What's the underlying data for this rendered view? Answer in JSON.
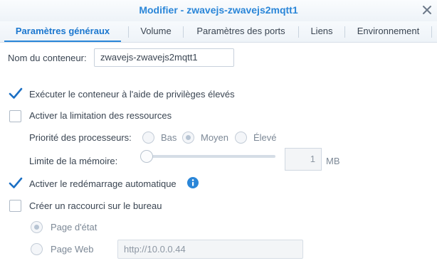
{
  "window": {
    "title": "Modifier - zwavejs-zwavejs2mqtt1"
  },
  "tabs": [
    {
      "label": "Paramètres généraux",
      "active": true
    },
    {
      "label": "Volume",
      "active": false
    },
    {
      "label": "Paramètres des ports",
      "active": false
    },
    {
      "label": "Liens",
      "active": false
    },
    {
      "label": "Environnement",
      "active": false
    }
  ],
  "container_name": {
    "label": "Nom du conteneur:",
    "value": "zwavejs-zwavejs2mqtt1"
  },
  "privileged": {
    "label": "Exécuter le conteneur à l'aide de privilèges élevés",
    "checked": true
  },
  "resource_limit": {
    "label": "Activer la limitation des ressources",
    "checked": false,
    "cpu_priority": {
      "label": "Priorité des processeurs:",
      "options": [
        "Bas",
        "Moyen",
        "Élevé"
      ],
      "selected": "Moyen"
    },
    "memory_limit": {
      "label": "Limite de la mémoire:",
      "value": "1",
      "unit": "MB"
    }
  },
  "auto_restart": {
    "label": "Activer le redémarrage automatique",
    "checked": true
  },
  "desktop_shortcut": {
    "label": "Créer un raccourci sur le bureau",
    "checked": false,
    "options": {
      "status_page": "Page d'état",
      "web_page": "Page Web"
    },
    "selected": "Page d'état",
    "url_value": "http://10.0.0.44"
  },
  "colors": {
    "accent": "#2a86d8",
    "checkbox_check": "#1b6fc4"
  }
}
